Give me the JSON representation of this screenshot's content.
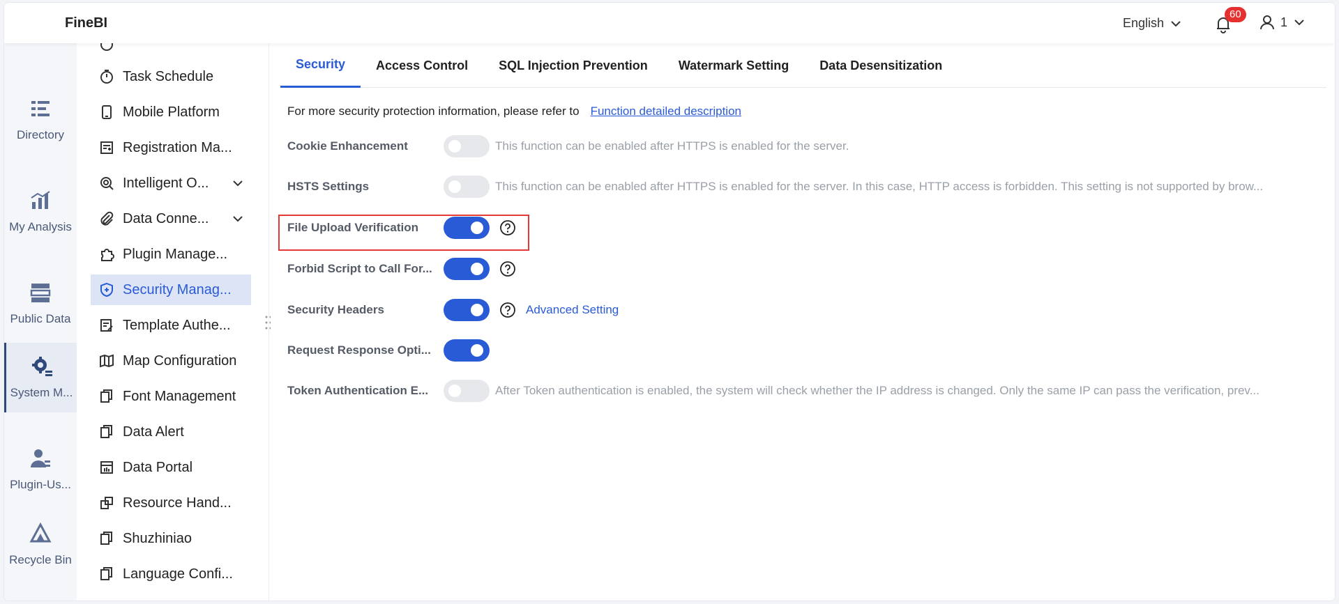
{
  "header": {
    "logo": "FineBI",
    "language": "English",
    "notification_count": "60",
    "user_name": "1"
  },
  "rail": {
    "items": [
      {
        "label": "Directory",
        "icon": "directory-icon"
      },
      {
        "label": "My Analysis",
        "icon": "analysis-icon"
      },
      {
        "label": "Public Data",
        "icon": "public-data-icon"
      },
      {
        "label": "System M...",
        "icon": "gear-icon",
        "active": true
      },
      {
        "label": "Plugin-Us...",
        "icon": "user-icon"
      },
      {
        "label": "Recycle Bin",
        "icon": "recycle-icon"
      }
    ]
  },
  "submenu": {
    "items": [
      {
        "label": "Task Schedule"
      },
      {
        "label": "Mobile Platform"
      },
      {
        "label": "Registration Ma..."
      },
      {
        "label": "Intelligent O...",
        "expandable": true
      },
      {
        "label": "Data Conne...",
        "expandable": true
      },
      {
        "label": "Plugin Manage..."
      },
      {
        "label": "Security Manag...",
        "active": true
      },
      {
        "label": "Template Authe..."
      },
      {
        "label": "Map Configuration"
      },
      {
        "label": "Font Management"
      },
      {
        "label": "Data Alert"
      },
      {
        "label": "Data Portal"
      },
      {
        "label": "Resource Hand..."
      },
      {
        "label": "Shuzhiniao"
      },
      {
        "label": "Language Confi..."
      }
    ]
  },
  "tabs": [
    {
      "label": "Security",
      "active": true
    },
    {
      "label": "Access Control"
    },
    {
      "label": "SQL Injection Prevention"
    },
    {
      "label": "Watermark Setting"
    },
    {
      "label": "Data Desensitization"
    }
  ],
  "intro": {
    "text": "For more security protection information, please refer to",
    "link": "Function detailed description"
  },
  "settings": [
    {
      "label": "Cookie Enhancement",
      "on": false,
      "desc": "This function can be enabled after HTTPS is enabled for the server."
    },
    {
      "label": "HSTS Settings",
      "on": false,
      "desc": "This function can be enabled after HTTPS is enabled for the server. In this case, HTTP access is forbidden. This setting is not supported by brow..."
    },
    {
      "label": "File Upload Verification",
      "on": true,
      "help": true
    },
    {
      "label": "Forbid Script to Call For...",
      "on": true,
      "help": true
    },
    {
      "label": "Security Headers",
      "on": true,
      "help": true,
      "link": "Advanced Setting"
    },
    {
      "label": "Request Response Opti...",
      "on": true
    },
    {
      "label": "Token Authentication E...",
      "on": false,
      "desc": "After Token authentication is enabled, the system will check whether the IP address is changed. Only the same IP can pass the verification, prev..."
    }
  ],
  "colors": {
    "accent": "#2a5bd7",
    "highlight": "#e53935",
    "badge": "#e5302f"
  }
}
